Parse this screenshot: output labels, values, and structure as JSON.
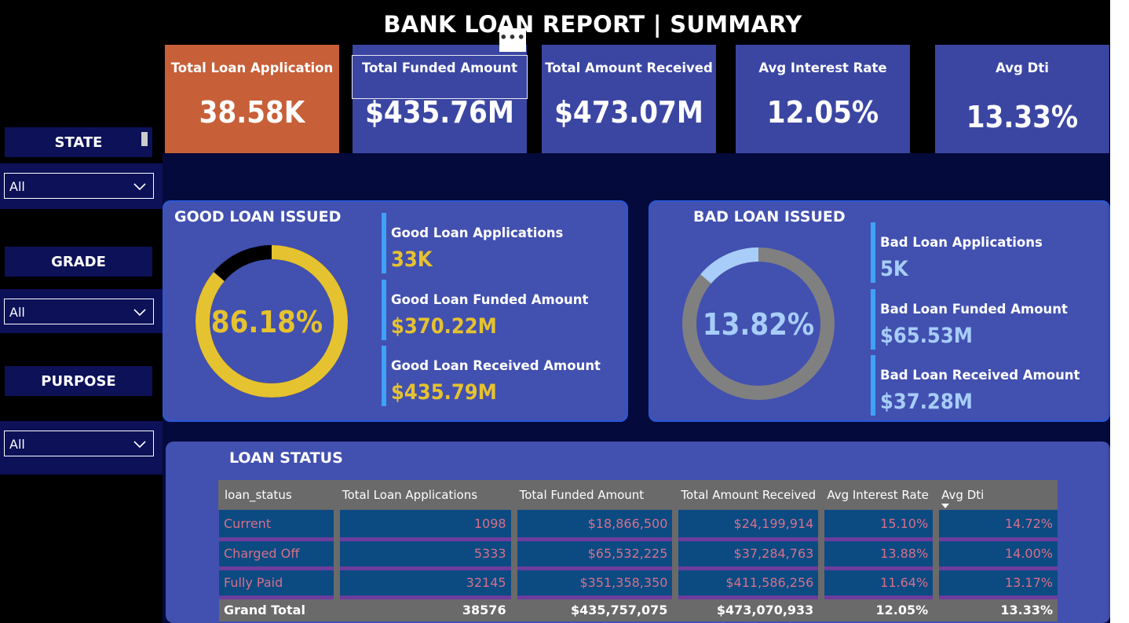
{
  "page": {
    "title": "BANK LOAN REPORT | SUMMARY",
    "more_label": "•••"
  },
  "kpis": [
    {
      "label": "Total Loan Application",
      "value": "38.58K"
    },
    {
      "label": "Total Funded Amount",
      "value": "$435.76M"
    },
    {
      "label": "Total Amount Received",
      "value": "$473.07M"
    },
    {
      "label": "Avg Interest Rate",
      "value": "12.05%"
    },
    {
      "label": "Avg Dti",
      "value": "13.33%"
    }
  ],
  "slicers": [
    {
      "title": "STATE",
      "value": "All"
    },
    {
      "title": "GRADE",
      "value": "All"
    },
    {
      "title": "PURPOSE",
      "value": "All"
    }
  ],
  "good_loan": {
    "title": "GOOD LOAN ISSUED",
    "percent_label": "86.18%",
    "percent": 86.18,
    "metrics": [
      {
        "label": "Good Loan Applications",
        "value": "33K"
      },
      {
        "label": "Good Loan Funded Amount",
        "value": "$370.22M"
      },
      {
        "label": "Good Loan Received Amount",
        "value": "$435.79M"
      }
    ]
  },
  "bad_loan": {
    "title": "BAD LOAN ISSUED",
    "percent_label": "13.82%",
    "percent": 13.82,
    "metrics": [
      {
        "label": "Bad Loan Applications",
        "value": "5K"
      },
      {
        "label": "Bad Loan Funded Amount",
        "value": "$65.53M"
      },
      {
        "label": "Bad Loan Received Amount",
        "value": "$37.28M"
      }
    ]
  },
  "loan_status": {
    "title": "LOAN STATUS",
    "columns": [
      "loan_status",
      "Total Loan Applications",
      "Total Funded Amount",
      "Total Amount Received",
      "Avg Interest Rate",
      "Avg Dti"
    ],
    "rows": [
      [
        "Current",
        "1098",
        "$18,866,500",
        "$24,199,914",
        "15.10%",
        "14.72%"
      ],
      [
        "Charged Off",
        "5333",
        "$65,532,225",
        "$37,284,763",
        "13.88%",
        "14.00%"
      ],
      [
        "Fully Paid",
        "32145",
        "$351,358,350",
        "$411,586,256",
        "11.64%",
        "13.17%"
      ]
    ],
    "total": [
      "Grand Total",
      "38576",
      "$435,757,075",
      "$473,070,933",
      "12.05%",
      "13.33%"
    ]
  },
  "colors": {
    "good_accent": "#e5c22f",
    "good_remainder": "#000000",
    "bad_accent": "#a7cdf8",
    "bad_remainder": "#808080",
    "panel": "#4250b0",
    "kpi_highlight": "#c75f38"
  }
}
